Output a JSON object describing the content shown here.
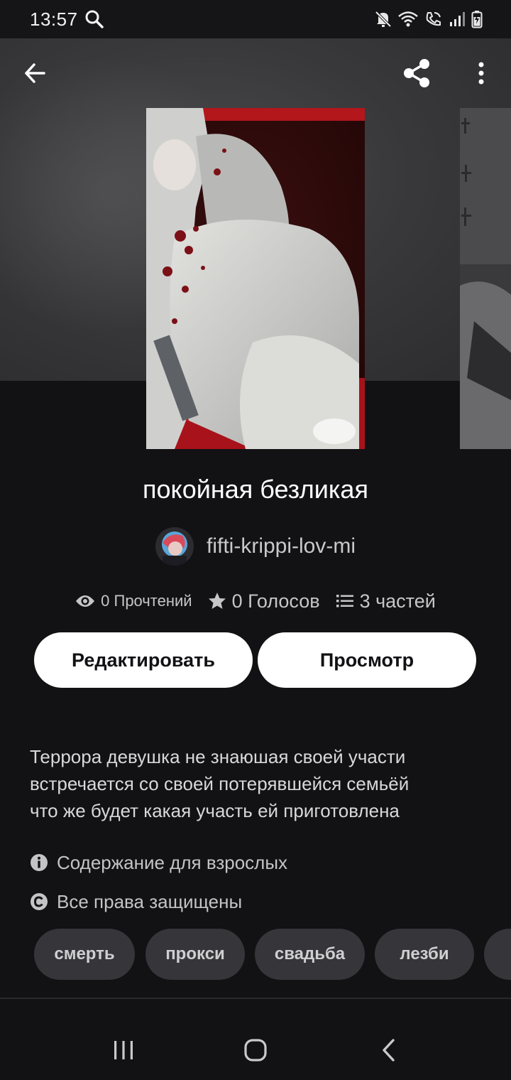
{
  "status_bar": {
    "time": "13:57",
    "icons": [
      "search-icon",
      "mute-icon",
      "wifi-icon",
      "wifi-call-icon",
      "signal-icon",
      "battery-icon"
    ]
  },
  "header": {
    "icons": [
      "back-arrow-icon",
      "share-icon",
      "more-vertical-icon"
    ]
  },
  "story": {
    "title": "покойная безликая",
    "author": "fifti-krippi-lov-mi",
    "stats": {
      "reads": "0 Прочтений",
      "votes": "0 Голосов",
      "parts": "3 частей"
    },
    "description": "Террора девушка не знаюшая своей участи\nвстречается со своей потерявшейся семьёй\nчто же будет какая  участь ей приготовлена",
    "mature_label": "Содержание для взрослых",
    "rights_label": "Все права защищены",
    "tags": [
      "смерть",
      "прокси",
      "свадьба",
      "лезби"
    ]
  },
  "actions": {
    "edit_label": "Редактировать",
    "view_label": "Просмотр"
  },
  "colors": {
    "background": "#121114",
    "button": "#ffffff",
    "tag_background": "#36363a"
  },
  "nav_bar": {
    "icons": [
      "recent-apps-icon",
      "home-icon",
      "back-icon"
    ]
  }
}
